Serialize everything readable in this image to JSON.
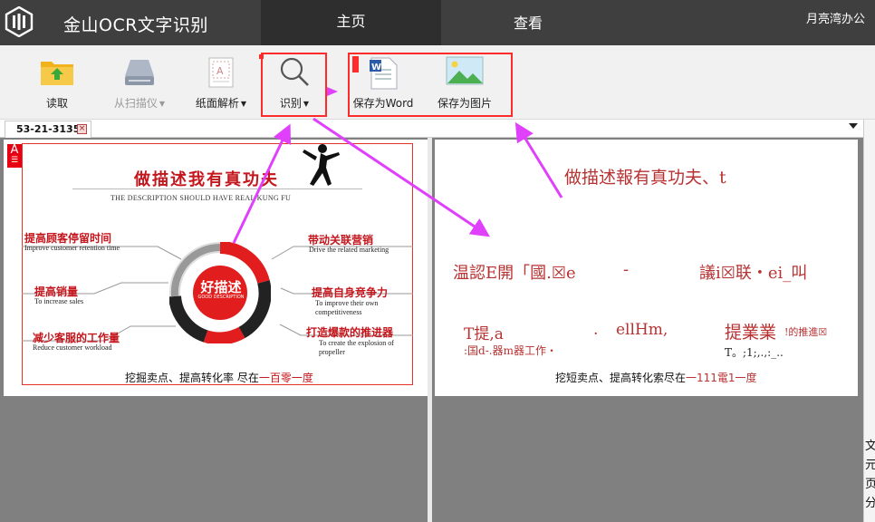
{
  "app": {
    "title": "金山OCR文字识别",
    "user": "月亮湾办公"
  },
  "nav": {
    "tab_main": "主页",
    "tab_view": "查看"
  },
  "toolbar": {
    "read": "读取",
    "scanner": "从扫描仪",
    "paper_parse": "纸面解析",
    "recognize": "识别",
    "save_word": "保存为Word",
    "save_image": "保存为图片"
  },
  "doc_tab": {
    "name": "53-21-3135",
    "close": "×"
  },
  "scan": {
    "badge": "A",
    "title": "做描述我有真功夫",
    "subtitle": "THE DESCRIPTION SHOULD HAVE REAL KUNG FU",
    "center": "好描述",
    "center_sub": "GOOD DESCRIPTION",
    "labels": [
      {
        "cn": "提高顾客停留时间",
        "en": "Improve customer retention time"
      },
      {
        "cn": "提高销量",
        "en": "To increase sales"
      },
      {
        "cn": "减少客服的工作量",
        "en": "Reduce customer workload"
      },
      {
        "cn": "带动关联营销",
        "en": "Drive the related marketing"
      },
      {
        "cn": "提高自身竞争力",
        "en": "To improve their own competitiveness"
      },
      {
        "cn": "打造爆款的推进器",
        "en": "To create the explosion of propeller"
      }
    ],
    "footer_black": "挖掘卖点、提高转化率 尽在",
    "footer_red": "一百零一度"
  },
  "ocr": {
    "line1": "做描述報有真功夫、t",
    "line2a": "温認E開「國.☒e",
    "line2b": "-",
    "line2c": "議i☒联・ei_叫",
    "line3a": "T提,a",
    "line3b": ".",
    "line3c": "ellHm,",
    "line3d": "提業業",
    "line3e": "!的推進☒",
    "line4a": ":国d-.器m器工作・",
    "line4b": "T。;1;,.,:_..",
    "line5a": "挖短卖点、提高转化索尽在",
    "line5b": "一111電1一度"
  },
  "side": {
    "chars": [
      "文",
      "元",
      "页",
      "分"
    ]
  },
  "colors": {
    "accent_box": "#ff2a2a",
    "arrow": "#e040fb",
    "brand_red": "#c4161c"
  }
}
